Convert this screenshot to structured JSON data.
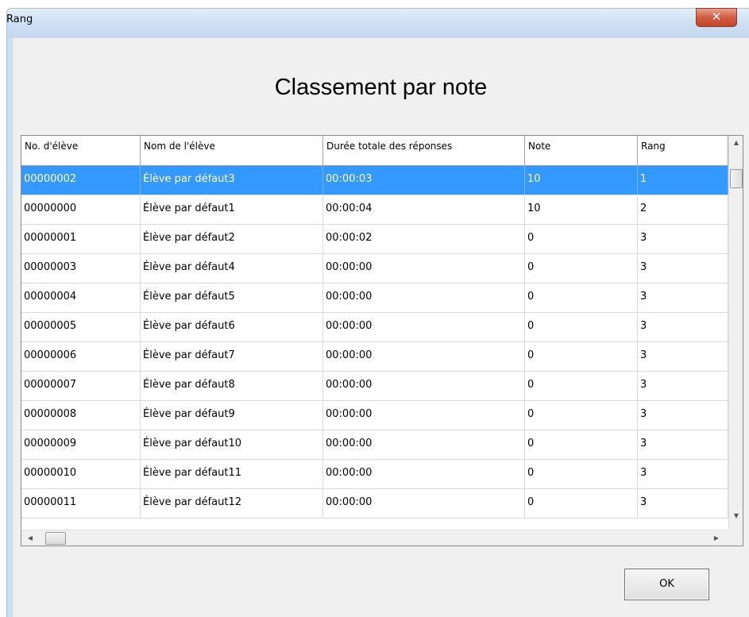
{
  "window": {
    "title": "Rang",
    "close_glyph": "✕"
  },
  "heading": "Classement par note",
  "table": {
    "columns": [
      "No. d'élève",
      "Nom de l'élève",
      "Durée totale des réponses",
      "Note",
      "Rang"
    ],
    "rows": [
      [
        "00000002",
        "Élève par défaut3",
        "00:00:03",
        "10",
        "1"
      ],
      [
        "00000000",
        "Élève par défaut1",
        "00:00:04",
        "10",
        "2"
      ],
      [
        "00000001",
        "Élève par défaut2",
        "00:00:02",
        "0",
        "3"
      ],
      [
        "00000003",
        "Élève par défaut4",
        "00:00:00",
        "0",
        "3"
      ],
      [
        "00000004",
        "Élève par défaut5",
        "00:00:00",
        "0",
        "3"
      ],
      [
        "00000005",
        "Élève par défaut6",
        "00:00:00",
        "0",
        "3"
      ],
      [
        "00000006",
        "Élève par défaut7",
        "00:00:00",
        "0",
        "3"
      ],
      [
        "00000007",
        "Élève par défaut8",
        "00:00:00",
        "0",
        "3"
      ],
      [
        "00000008",
        "Élève par défaut9",
        "00:00:00",
        "0",
        "3"
      ],
      [
        "00000009",
        "Élève par défaut10",
        "00:00:00",
        "0",
        "3"
      ],
      [
        "00000010",
        "Élève par défaut11",
        "00:00:00",
        "0",
        "3"
      ],
      [
        "00000011",
        "Élève par défaut12",
        "00:00:00",
        "0",
        "3"
      ]
    ],
    "selected_row": 0
  },
  "scroll": {
    "up": "▲",
    "down": "▼",
    "left": "◀",
    "right": "▶"
  },
  "ok_label": "OK",
  "colors": {
    "selection": "#3399ff",
    "close": "#c4442a"
  }
}
